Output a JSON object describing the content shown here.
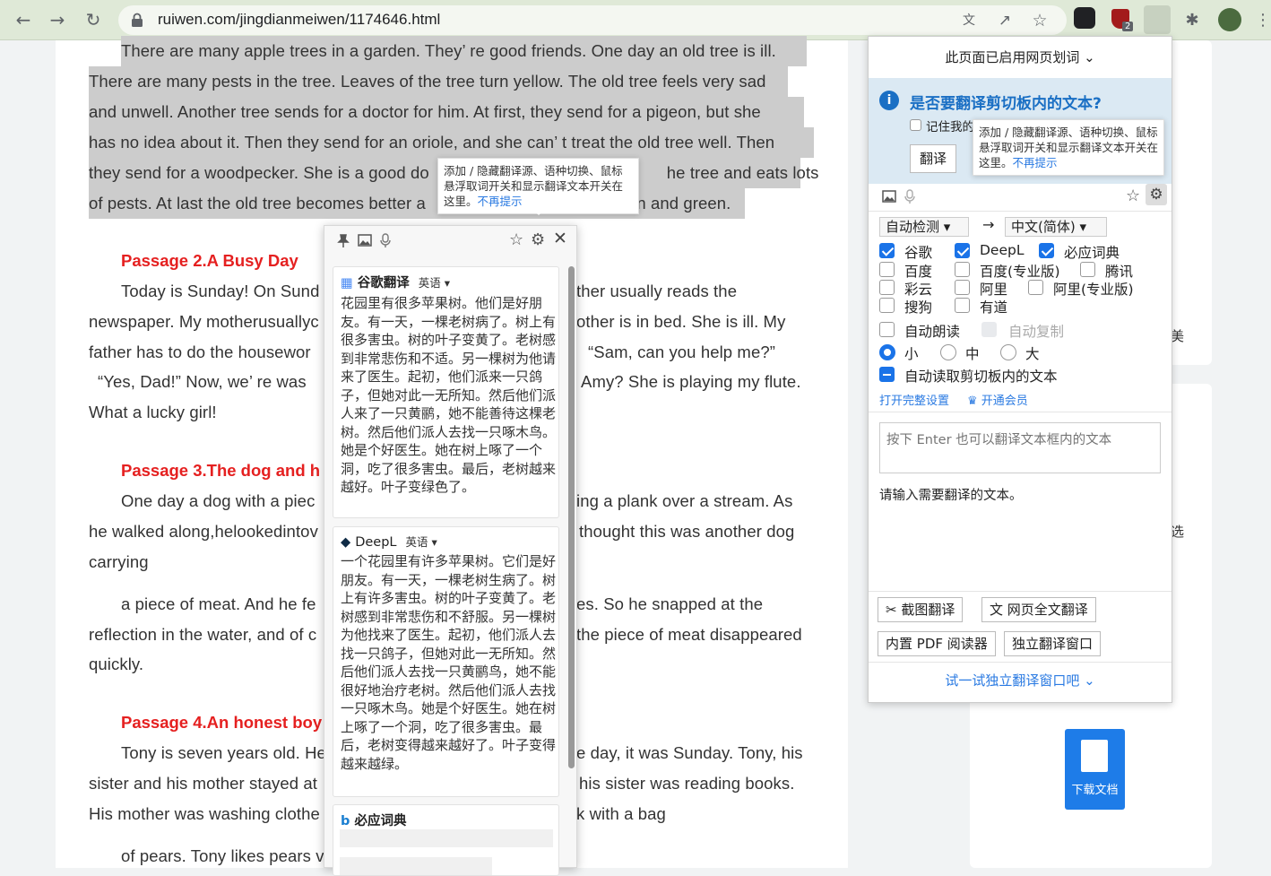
{
  "browser": {
    "url": "ruiwen.com/jingdianmeiwen/1174646.html",
    "extension_badge": "2"
  },
  "article": {
    "p1_lines": [
      "There are many apple trees in a garden. They’ re good friends. One day an old tree is ill.",
      "There are many pests in the tree. Leaves of the tree turn yellow. The old tree feels very sad",
      "and unwell. Another tree sends for a doctor for him. At first, they send for a pigeon, but she",
      "has no idea about it. Then they send for an oriole, and she can’ t treat the old tree well. Then",
      "they send for a woodpecker. She is a good do",
      "he tree and eats lots",
      "of pests. At last the old tree becomes better a",
      "en and green."
    ],
    "passage2_title": "Passage 2.A Busy Day",
    "p2_lines": [
      [
        "Today is Sunday! On Sund",
        "ther usually reads the"
      ],
      [
        "newspaper. My motherusuallyc",
        "other is in bed. She is ill. My"
      ],
      [
        "father has to do the housewor",
        "“Sam, can you help me?”"
      ],
      [
        "“Yes, Dad!”  Now, we’ re was",
        "Amy? She is playing my flute."
      ],
      [
        "What a lucky girl!",
        ""
      ]
    ],
    "passage3_title": "Passage 3.The dog and h",
    "p3_lines": [
      [
        "One day a dog with a piec",
        "ing a plank over a stream. As"
      ],
      [
        "he walked along,helookedintov",
        "thought this was another dog"
      ],
      [
        "carrying",
        ""
      ],
      [
        "a piece of meat. And he fe",
        "es. So he snapped at the"
      ],
      [
        "reflection in the water, and of c",
        "the piece of meat disappeared"
      ],
      [
        "quickly.",
        ""
      ]
    ],
    "passage4_title": "Passage 4.An honest boy",
    "p4_lines": [
      [
        "Tony is seven years old. He",
        "e day, it was Sunday. Tony, his"
      ],
      [
        "sister and his mother stayed at",
        "his sister was reading books."
      ],
      [
        "His mother was washing clothe",
        "k with a bag"
      ],
      [
        "of pears. Tony likes pears v",
        ""
      ]
    ]
  },
  "tooltip": {
    "text": "添加 / 隐藏翻译源、语种切换、鼠标悬浮取词开关和显示翻译文本开关在这里。",
    "link": "不再提示"
  },
  "popup": {
    "google": {
      "name": "谷歌翻译",
      "lang": "英语",
      "text": "花园里有很多苹果树。他们是好朋友。有一天，一棵老树病了。树上有很多害虫。树的叶子变黄了。老树感到非常悲伤和不适。另一棵树为他请来了医生。起初，他们派来一只鸽子，但她对此一无所知。然后他们派人来了一只黄鹂，她不能善待这棵老树。然后他们派人去找一只啄木鸟。她是个好医生。她在树上啄了一个洞，吃了很多害虫。最后，老树越来越好。叶子变绿色了。"
    },
    "deepl": {
      "name": "DeepL",
      "lang": "英语",
      "text": "一个花园里有许多苹果树。它们是好朋友。有一天，一棵老树生病了。树上有许多害虫。树的叶子变黄了。老树感到非常悲伤和不舒服。另一棵树为他找来了医生。起初，他们派人去找一只鸽子，但她对此一无所知。然后他们派人去找一只黄鹂鸟，她不能很好地治疗老树。然后他们派人去找一只啄木鸟。她是个好医生。她在树上啄了一个洞，吃了很多害虫。最后，老树变得越来越好了。叶子变得越来越绿。"
    },
    "bing": {
      "name": "必应词典"
    }
  },
  "panel": {
    "header": "此页面已启用网页划词",
    "question": "是否要翻译剪切板内的文本?",
    "remember": "记住我的",
    "translate_btn": "翻译",
    "source_lang": "自动检测",
    "target_lang": "中文(简体)",
    "engines": [
      {
        "name": "谷歌",
        "checked": true
      },
      {
        "name": "DeepL",
        "checked": true
      },
      {
        "name": "必应词典",
        "checked": true
      },
      {
        "name": "百度",
        "checked": false
      },
      {
        "name": "百度(专业版)",
        "checked": false
      },
      {
        "name": "腾讯",
        "checked": false
      },
      {
        "name": "彩云",
        "checked": false
      },
      {
        "name": "阿里",
        "checked": false
      },
      {
        "name": "阿里(专业版)",
        "checked": false
      },
      {
        "name": "搜狗",
        "checked": false
      },
      {
        "name": "有道",
        "checked": false
      }
    ],
    "auto_read": "自动朗读",
    "auto_copy": "自动复制",
    "size_small": "小",
    "size_medium": "中",
    "size_large": "大",
    "auto_clipboard": "自动读取剪切板内的文本",
    "open_settings": "打开完整设置",
    "vip": "开通会员",
    "input_placeholder": "按下 Enter 也可以翻译文本框内的文本",
    "hint": "请输入需要翻译的文本。",
    "screenshot_btn": "截图翻译",
    "fullpage_btn": "网页全文翻译",
    "pdf_btn": "内置 PDF 阅读器",
    "window_btn": "独立翻译窗口",
    "footer": "试一试独立翻译窗口吧"
  },
  "side_fragments": [
    "美",
    "选"
  ],
  "download_label": "下载文档"
}
